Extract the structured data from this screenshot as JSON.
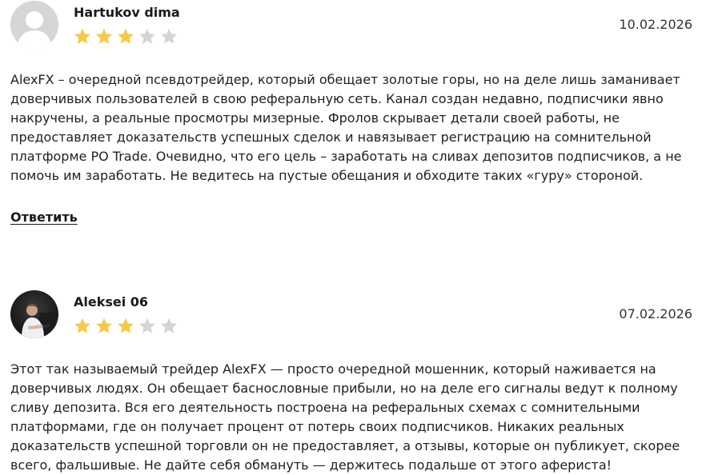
{
  "reviews": [
    {
      "author": "Hartukov dima",
      "date": "10.02.2026",
      "rating": 3,
      "rating_max": 5,
      "avatar": "default-user-icon",
      "text": "AlexFX – очередной псевдотрейдер, который обещает золотые горы, но на деле лишь заманивает доверчивых пользователей в свою реферальную сеть. Канал создан недавно, подписчики явно накручены, а реальные просмотры мизерные. Фролов скрывает детали своей работы, не предоставляет доказательств успешных сделок и навязывает регистрацию на сомнительной платформе PO Trade. Очевидно, что его цель – заработать на сливах депозитов подписчиков, а не помочь им заработать. Не ведитесь на пустые обещания и обходите таких «гуру» стороной.",
      "reply_label": "Ответить"
    },
    {
      "author": "Aleksei 06",
      "date": "07.02.2026",
      "rating": 3,
      "rating_max": 5,
      "avatar": "user-photo",
      "text": "Этот так называемый трейдер AlexFX — просто очередной мошенник, который наживается на доверчивых людях. Он обещает баснословные прибыли, но на деле его сигналы ведут к полному сливу депозита. Вся его деятельность построена на реферальных схемах с сомнительными платформами, где он получает процент от потерь своих подписчиков. Никаких реальных доказательств успешной торговли он не предоставляет, а отзывы, которые он публикует, скорее всего, фальшивые. Не дайте себя обмануть — держитесь подальше от этого афериста!"
    }
  ],
  "colors": {
    "star_filled": "#f7c948",
    "star_empty": "#d4d4d4",
    "text": "#1f1f1f"
  }
}
